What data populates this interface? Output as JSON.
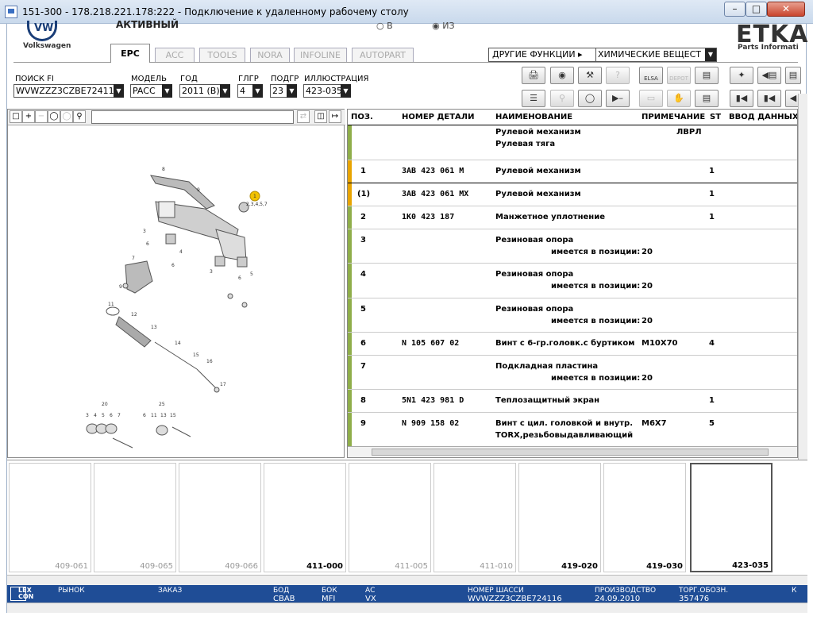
{
  "window": {
    "title": "151-300 - 178.218.221.178:222 - Подключение к удаленному рабочему столу",
    "min": "–",
    "max": "□",
    "close": "✕"
  },
  "header": {
    "brand": "Volkswagen",
    "brand_mark": "VW",
    "status": "АКТИВНЫЙ",
    "radio_in": "В",
    "radio_out": "ИЗ",
    "etka": "ETKA",
    "etka_sub": "Parts Informati"
  },
  "tabs": [
    {
      "label": "EPC"
    },
    {
      "label": "ACC"
    },
    {
      "label": "TOOLS"
    },
    {
      "label": "NORA"
    },
    {
      "label": "INFOLINE"
    },
    {
      "label": "AUTOPART"
    }
  ],
  "other_functions": {
    "label": "ДРУГИЕ ФУНКЦИИ ▸",
    "value": "ХИМИЧЕСКИЕ ВЕЩЕСТ"
  },
  "search": {
    "fi_label": "ПОИСК FI",
    "fi_value": "WVWZZZ3CZBE72411",
    "model_label": "МОДЕЛЬ",
    "model_value": "PACC",
    "year_label": "ГОД",
    "year_value": "2011 (B)",
    "group_label": "ГЛГР",
    "group_value": "4",
    "subgroup_label": "ПОДГР",
    "subgroup_value": "23",
    "illustration_label": "ИЛЛЮСТРАЦИЯ",
    "illustration_value": "423-035"
  },
  "toolbar": {
    "print": "🖨",
    "elsa": "ELSA",
    "depot": "DEPOT",
    "basket": "🛒",
    "pin": "📌",
    "prev": "◀",
    "first": "⏮",
    "stepback": "⏴"
  },
  "parts_table": {
    "headers": {
      "pos": "ПОЗ.",
      "part_no": "НОМЕР ДЕТАЛИ",
      "name": "НАИМЕНОВАНИЕ",
      "note": "ПРИМЕЧАНИЕ",
      "st": "ST",
      "input": "ВВОД ДАННЫХ Г"
    },
    "rows": [
      {
        "pos": "",
        "part": "",
        "name": "Рулевой механизм",
        "name2": "Рулевая тяга",
        "note": "ЛВРЛ",
        "st": ""
      },
      {
        "pos": "1",
        "part": "3AB 423 061 M",
        "name": "Рулевой механизм",
        "name2": "",
        "note": "",
        "st": "1"
      },
      {
        "pos": "(1)",
        "part": "3AB 423 061 MX",
        "name": "Рулевой механизм",
        "name2": "",
        "note": "",
        "st": "1"
      },
      {
        "pos": "2",
        "part": "1K0 423 187",
        "name": "Манжетное уплотнение",
        "name2": "",
        "note": "",
        "st": "1"
      },
      {
        "pos": "3",
        "part": "",
        "name": "Резиновая опора",
        "name2": "имеется в позиции:",
        "note": "20",
        "st": ""
      },
      {
        "pos": "4",
        "part": "",
        "name": "Резиновая опора",
        "name2": "имеется в позиции:",
        "note": "20",
        "st": ""
      },
      {
        "pos": "5",
        "part": "",
        "name": "Резиновая опора",
        "name2": "имеется в позиции:",
        "note": "20",
        "st": ""
      },
      {
        "pos": "6",
        "part": "N 105 607 02",
        "name": "Винт с 6-гр.головк.с буртиком",
        "name2": "",
        "note": "M10X70",
        "st": "4"
      },
      {
        "pos": "7",
        "part": "",
        "name": "Подкладная пластина",
        "name2": "имеется в позиции:",
        "note": "20",
        "st": ""
      },
      {
        "pos": "8",
        "part": "5N1 423 981 D",
        "name": "Теплозащитный экран",
        "name2": "",
        "note": "",
        "st": "1"
      },
      {
        "pos": "9",
        "part": "N 909 158 02",
        "name": "Винт с цил. головкой и внутр.",
        "name2": "TORX,резьбовыдавливающий",
        "note": "M6X7",
        "st": "5"
      }
    ]
  },
  "diagram_labels": [
    "8",
    "9",
    "1",
    "2,3,4,5,7",
    "3",
    "6",
    "4",
    "6",
    "3",
    "5",
    "6",
    "9",
    "7",
    "11",
    "12",
    "13",
    "14",
    "15",
    "16",
    "17",
    "20",
    "3",
    "4",
    "5",
    "6",
    "7",
    "25",
    "6",
    "11",
    "13",
    "15"
  ],
  "thumbnails": [
    {
      "label": "409-061",
      "active": false
    },
    {
      "label": "409-065",
      "active": false
    },
    {
      "label": "409-066",
      "active": false
    },
    {
      "label": "411-000",
      "active": true
    },
    {
      "label": "411-005",
      "active": false
    },
    {
      "label": "411-010",
      "active": false
    },
    {
      "label": "419-020",
      "active": true
    },
    {
      "label": "419-030",
      "active": true
    },
    {
      "label": "423-035",
      "active": true
    }
  ],
  "statusbar": {
    "lex": "LEX",
    "con": "CON",
    "market_label": "РЫНОК",
    "order_label": "ЗАКАЗ",
    "bod_label": "БОД",
    "bod_value": "CBAB",
    "bok_label": "БОК",
    "bok_value": "MFI",
    "ac_label": "АС",
    "ac_value": "VX",
    "chassis_label": "НОМЕР ШАССИ",
    "chassis_value": "WVWZZZ3CZBE724116",
    "prod_label": "ПРОИЗВОДСТВО",
    "prod_value": "24.09.2010",
    "trade_label": "ТОРГ.ОБОЗН.",
    "trade_value": "357476",
    "k_label": "К"
  },
  "colors": {
    "title_bg": "#dfe9f5",
    "status_bg": "#1f4d96",
    "row_marker": "#8fae4a",
    "row_marker_selected": "#e8a400",
    "callout": "#f2c200"
  }
}
